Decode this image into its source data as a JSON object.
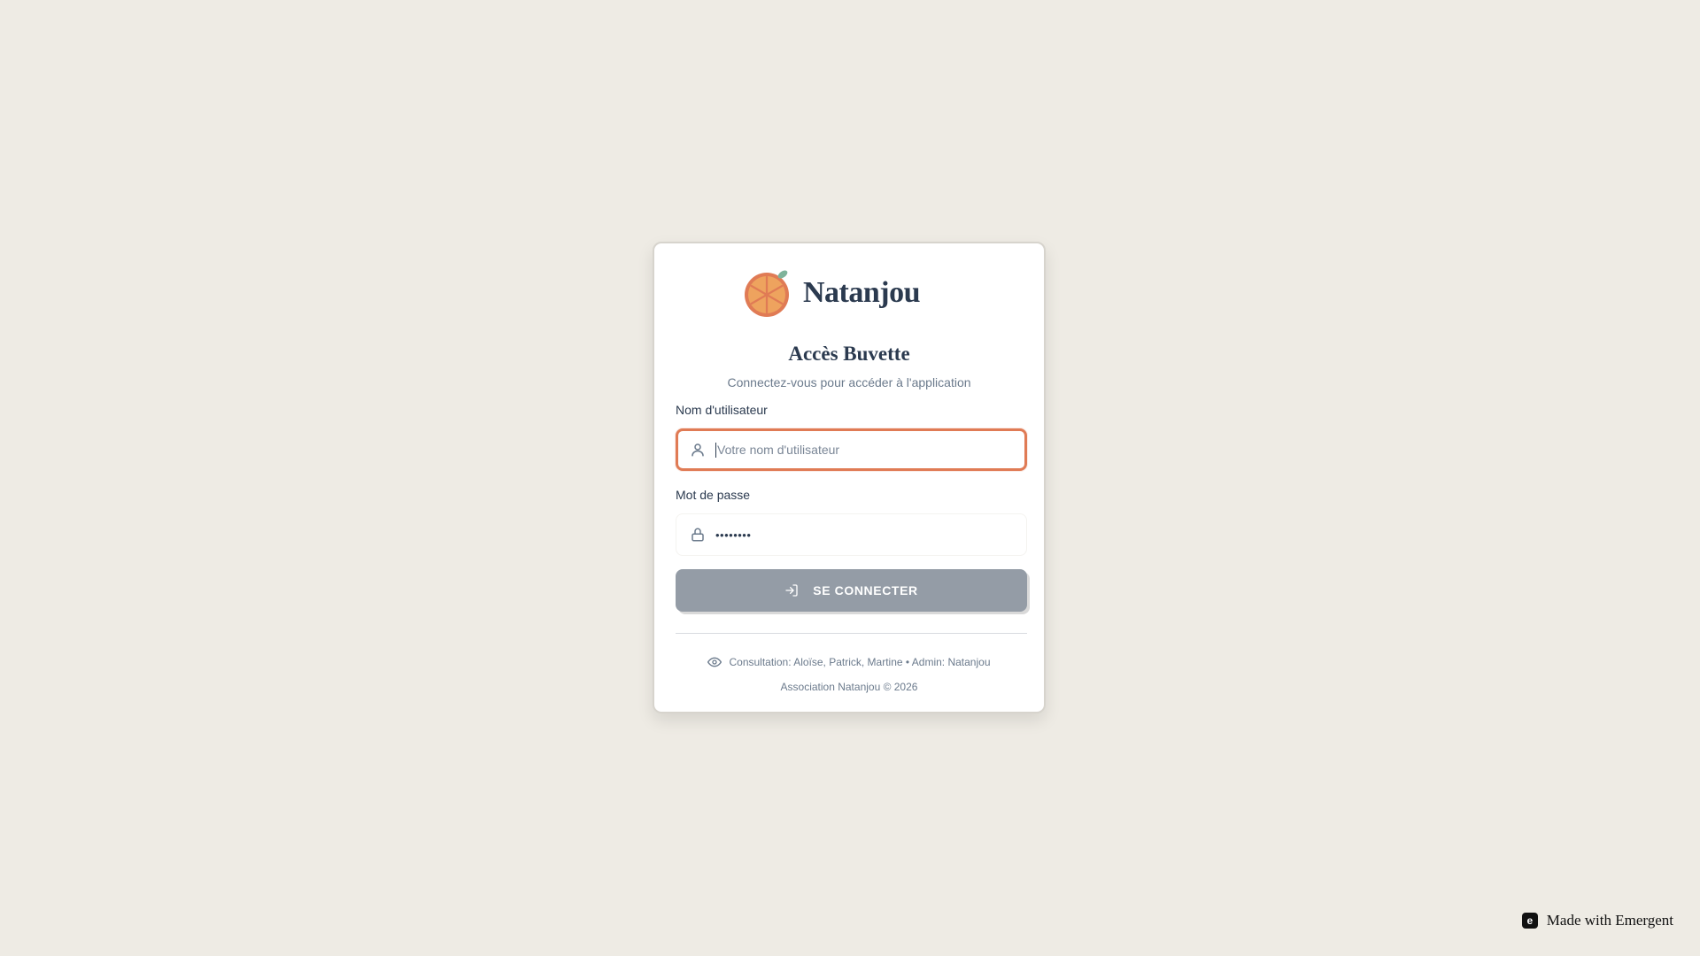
{
  "brand": {
    "name": "Natanjou",
    "logo_icon": "orange-slice-icon",
    "colors": {
      "orange": "#e8955a",
      "rind": "#e07b55",
      "leaf": "#7fb39a",
      "text": "#2b3a4f"
    }
  },
  "login": {
    "title": "Accès Buvette",
    "subtitle": "Connectez-vous pour accéder à l'application",
    "username": {
      "label": "Nom d'utilisateur",
      "placeholder": "Votre nom d'utilisateur",
      "value": "",
      "icon": "user-icon",
      "focused": true
    },
    "password": {
      "label": "Mot de passe",
      "value": "••••••••",
      "icon": "lock-icon"
    },
    "submit": {
      "label": "SE CONNECTER",
      "icon": "login-arrow-icon",
      "color": "#949ca6"
    }
  },
  "footer": {
    "accounts_icon": "eye-icon",
    "accounts": "Consultation: Aloïse, Patrick, Martine • Admin: Natanjou",
    "copyright": "Association Natanjou © 2026"
  },
  "badge": {
    "label": "Made with Emergent",
    "icon": "emergent-logo-icon"
  }
}
